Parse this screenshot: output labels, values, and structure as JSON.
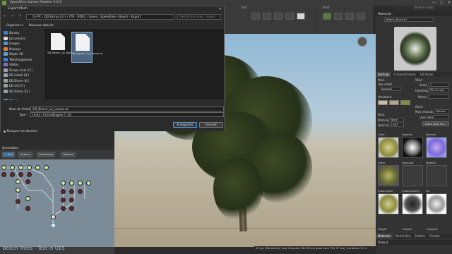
{
  "app": {
    "title": "SpeedTree Games Modeler 9.0.0",
    "win_controls": [
      "—",
      "□",
      "✕"
    ],
    "search_help": "Search Help"
  },
  "toolbar": {
    "groups": [
      {
        "label": "Edit"
      },
      {
        "label": "Pivot"
      }
    ]
  },
  "dialog": {
    "title": "Export Mesh",
    "close": "✕",
    "nav_buttons": [
      "←",
      "→",
      "↑"
    ],
    "breadcrumb": "Ce PC  ›  DD Extras (G:)  ›  YTB  ›  RDR2  ›  Saves  ›  Speedtree  ›  Beech  ›  Export",
    "search_placeholder": "Rechercher dans : Export",
    "organize": "Organiser ▾",
    "new_folder": "Nouveau dossier",
    "nav_items": [
      {
        "label": "Bureau",
        "color": "#3b7fd4"
      },
      {
        "label": "Documents",
        "color": "#d8d8d8"
      },
      {
        "label": "Images",
        "color": "#4a9ad8"
      },
      {
        "label": "Musique",
        "color": "#e07a3a"
      },
      {
        "label": "Objets 3D",
        "color": "#5aa0d8"
      },
      {
        "label": "Téléchargement",
        "color": "#3b7fd4"
      },
      {
        "label": "Vidéos",
        "color": "#8a6ad0"
      },
      {
        "label": "Disque local (C:)",
        "color": "#9aa0a6"
      },
      {
        "label": "DD Install (D:)",
        "color": "#9aa0a6"
      },
      {
        "label": "DD Divers (E:)",
        "color": "#9aa0a6"
      },
      {
        "label": "DD CGI (F:)",
        "color": "#9aa0a6"
      },
      {
        "label": "DD Extras (G:)",
        "color": "#9aa0a6"
      },
      {
        "label": "Réseau",
        "color": "#5a8ac8"
      }
    ],
    "files": [
      {
        "name": "SM_Beech_1a_Bark.st"
      },
      {
        "name": "SM_Beech_1a_Leaves.st"
      }
    ],
    "filename_label": "Nom du fichier :",
    "filename_value": "SM_Beech_1a_Leaves.st",
    "type_label": "Type :",
    "type_value": "Unity / UnrealEngine (*.st)",
    "save_button": "Enregistrer",
    "cancel_button": "Annuler",
    "hide_folders": "▲ Masquer les dossiers"
  },
  "generation": {
    "title": "Generation",
    "buttons": [
      "+ Add",
      "Actions",
      "Databases",
      "Options"
    ],
    "watermark": "Beech Trees - Test in UE5"
  },
  "viewport": {
    "status": "52 fps (Rendered), Last Compute 96.33 ms (draw time 792.57 ms), Iterations 2.5 e"
  },
  "right_panel": {
    "materials_header": "Materials",
    "material_name": "Beech_Branch1",
    "tabs": [
      "Settings",
      "Cutouts/Frames",
      "UV Areas"
    ],
    "props": {
      "main_label": "Main",
      "two_sided": "Two-sided",
      "flat_label": "Flat",
      "session": "Session",
      "variations": "Variations",
      "back": "Back",
      "material_label": "Material",
      "material_val": "None",
      "spacing_label": "Spacing",
      "spacing_val": "0.001",
      "wind_label": "Wind",
      "scale_label": "Scale",
      "scale_val": "1",
      "handling_label": "Handling",
      "handling_val": "Per-tri mat",
      "name_label": "Name",
      "other_label": "Other",
      "max_res_label": "Max resolution",
      "max_res_val": "Default",
      "user_data_label": "User data",
      "make_new_from": "Make New Fro..."
    },
    "tex_labels": [
      "Color",
      "Opacity",
      "Normal",
      "Gloss",
      "Specular",
      "Metallic",
      "Subsurface",
      "Subsurface%",
      "AO"
    ],
    "height_label": "Height",
    "custom_label": "Custom",
    "custom2_label": "Custom2",
    "bottom_tabs": [
      "Materials",
      "Partial Bins",
      "Profiles",
      "Presets",
      "Displacements"
    ],
    "output_label": "Output"
  }
}
